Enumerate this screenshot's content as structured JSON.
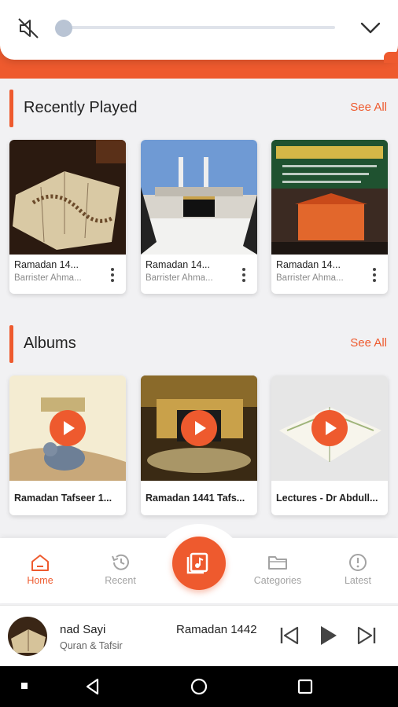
{
  "volume": {
    "level": 0.0
  },
  "recently_played": {
    "title": "Recently Played",
    "see_all": "See All",
    "items": [
      {
        "title": "Ramadan 14...",
        "subtitle": "Barrister Ahma..."
      },
      {
        "title": "Ramadan 14...",
        "subtitle": "Barrister Ahma..."
      },
      {
        "title": "Ramadan 14...",
        "subtitle": "Barrister Ahma..."
      }
    ]
  },
  "albums": {
    "title": "Albums",
    "see_all": "See All",
    "items": [
      {
        "title": "Ramadan Tafseer 1..."
      },
      {
        "title": "Ramadan 1441 Tafs..."
      },
      {
        "title": "Lectures - Dr Abdull..."
      }
    ]
  },
  "bottom_nav": {
    "items": [
      {
        "label": "Home",
        "icon": "home-icon",
        "active": true
      },
      {
        "label": "Recent",
        "icon": "history-icon",
        "active": false
      },
      {
        "label": "Categories",
        "icon": "folder-icon",
        "active": false
      },
      {
        "label": "Latest",
        "icon": "alert-circle-icon",
        "active": false
      }
    ]
  },
  "mini_player": {
    "title_left": "nad Sayi",
    "title_right": "Ramadan 1442",
    "subtitle": "Quran & Tafsir"
  },
  "colors": {
    "accent": "#ee5a2e",
    "background": "#f1f1f3"
  }
}
